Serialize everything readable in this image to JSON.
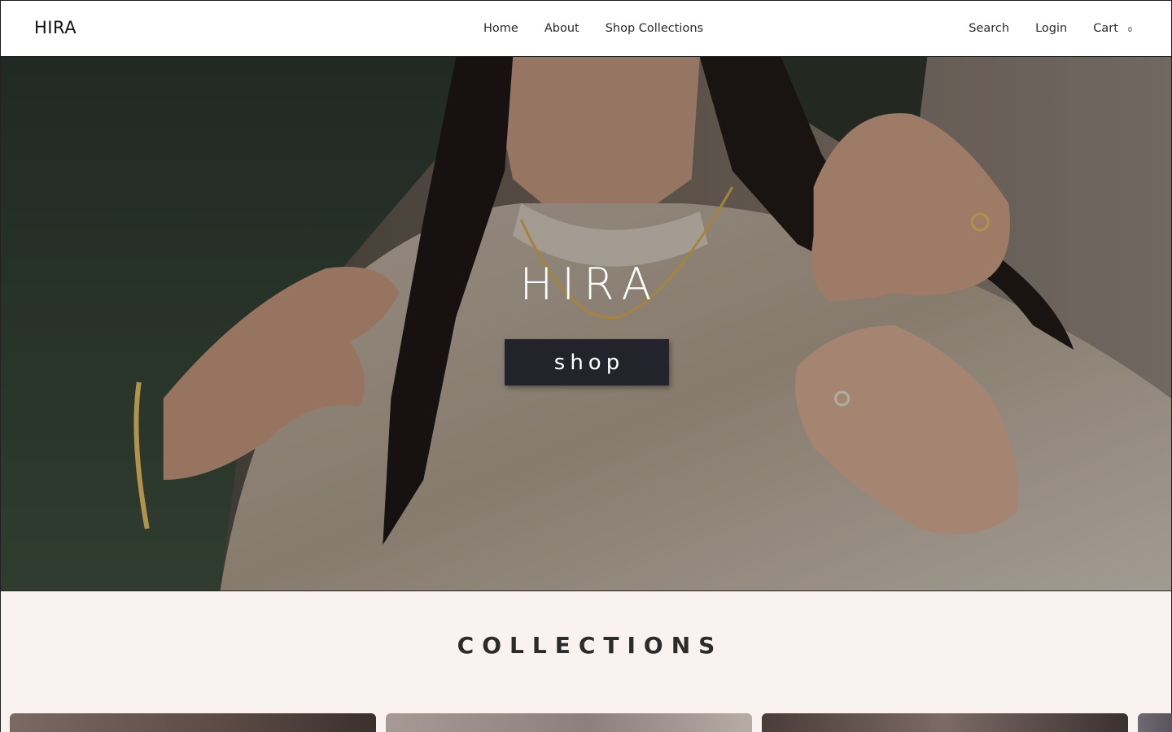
{
  "header": {
    "logo": "HIRA",
    "nav": [
      {
        "label": "Home"
      },
      {
        "label": "About"
      },
      {
        "label": "Shop Collections"
      }
    ],
    "utility": {
      "search": "Search",
      "login": "Login",
      "cart": "Cart",
      "cart_count": "0"
    }
  },
  "hero": {
    "title": "HIRA",
    "button_label": "shop"
  },
  "collections": {
    "heading": "COLLECTIONS",
    "card_count_visible": 4
  },
  "colors": {
    "button_bg": "#23232b",
    "collections_bg": "#faf2f1"
  }
}
